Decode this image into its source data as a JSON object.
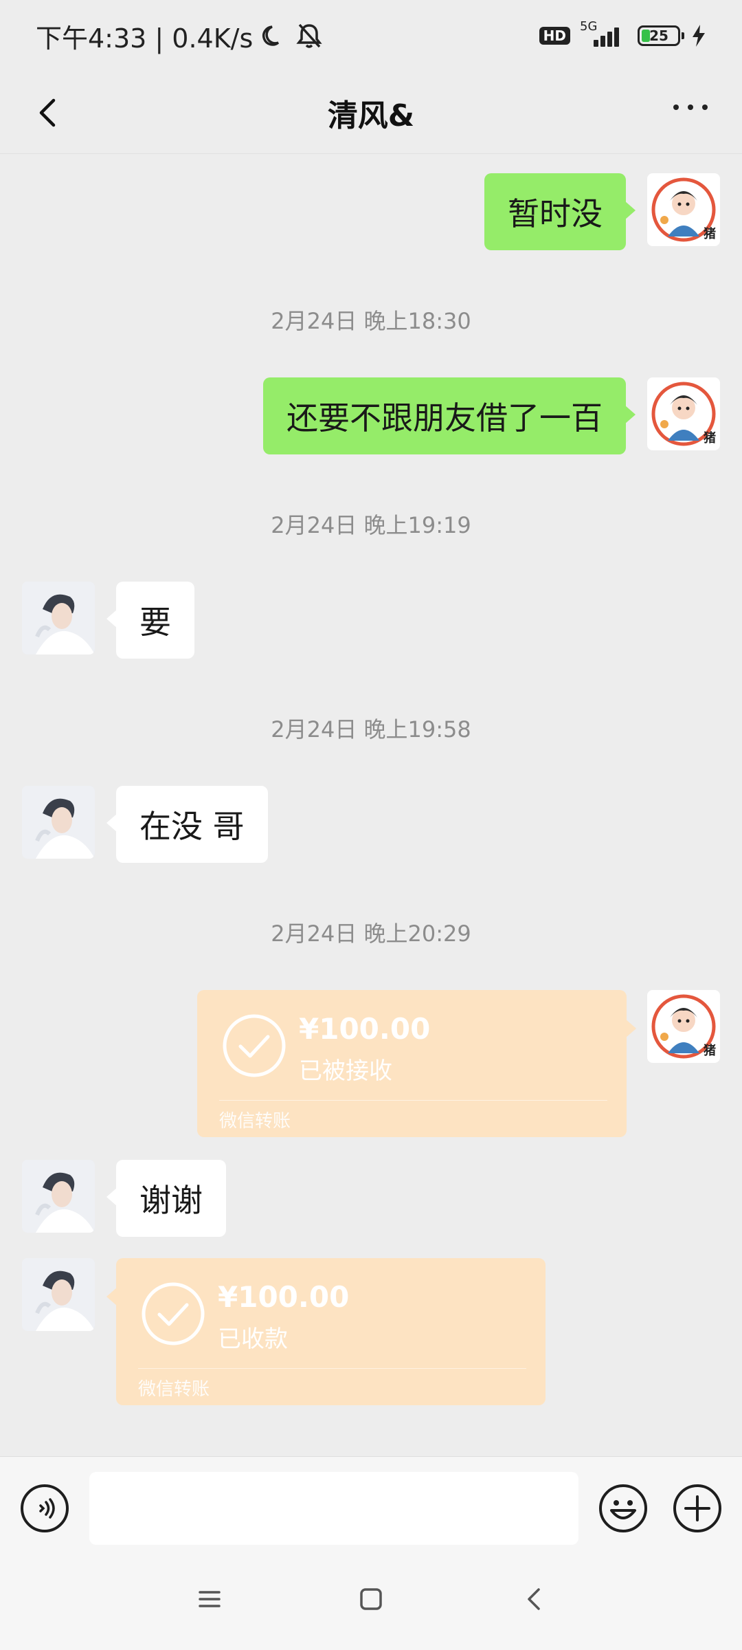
{
  "status_bar": {
    "time_speed": "下午4:33 | 0.4K/s",
    "hd_label": "HD",
    "network_label": "5G",
    "battery_level": "25",
    "icons": [
      "moon-icon",
      "mute-bell-icon",
      "signal-icon",
      "battery-icon",
      "charging-bolt-icon"
    ]
  },
  "header": {
    "title": "清风&",
    "back_icon": "chevron-left-icon",
    "more_icon": "more-dots-icon"
  },
  "messages": [
    {
      "sender": "self",
      "type": "text",
      "text": "暂时没"
    },
    {
      "type": "timestamp",
      "text": "2月24日 晚上18:30"
    },
    {
      "sender": "self",
      "type": "text",
      "text": "还要不跟朋友借了一百"
    },
    {
      "type": "timestamp",
      "text": "2月24日 晚上19:19"
    },
    {
      "sender": "other",
      "type": "text",
      "text": "要"
    },
    {
      "type": "timestamp",
      "text": "2月24日 晚上19:58"
    },
    {
      "sender": "other",
      "type": "text",
      "text": "在没 哥"
    },
    {
      "type": "timestamp",
      "text": "2月24日 晚上20:29"
    },
    {
      "sender": "self",
      "type": "transfer",
      "amount": "¥100.00",
      "status": "已被接收",
      "source": "微信转账"
    },
    {
      "sender": "other",
      "type": "text",
      "text": "谢谢"
    },
    {
      "sender": "other",
      "type": "transfer",
      "amount": "¥100.00",
      "status": "已收款",
      "source": "微信转账"
    }
  ],
  "self_avatar_badge": "猪",
  "input_bar": {
    "placeholder": "",
    "value": "",
    "icons": [
      "voice-icon",
      "emoji-icon",
      "plus-icon"
    ]
  },
  "nav_bar": {
    "icons": [
      "menu-icon",
      "home-icon",
      "back-icon"
    ]
  },
  "colors": {
    "background": "#ededed",
    "self_bubble": "#95ec69",
    "other_bubble": "#ffffff",
    "transfer_card": "#fde3c2",
    "timestamp_text": "#8c8c8c"
  }
}
